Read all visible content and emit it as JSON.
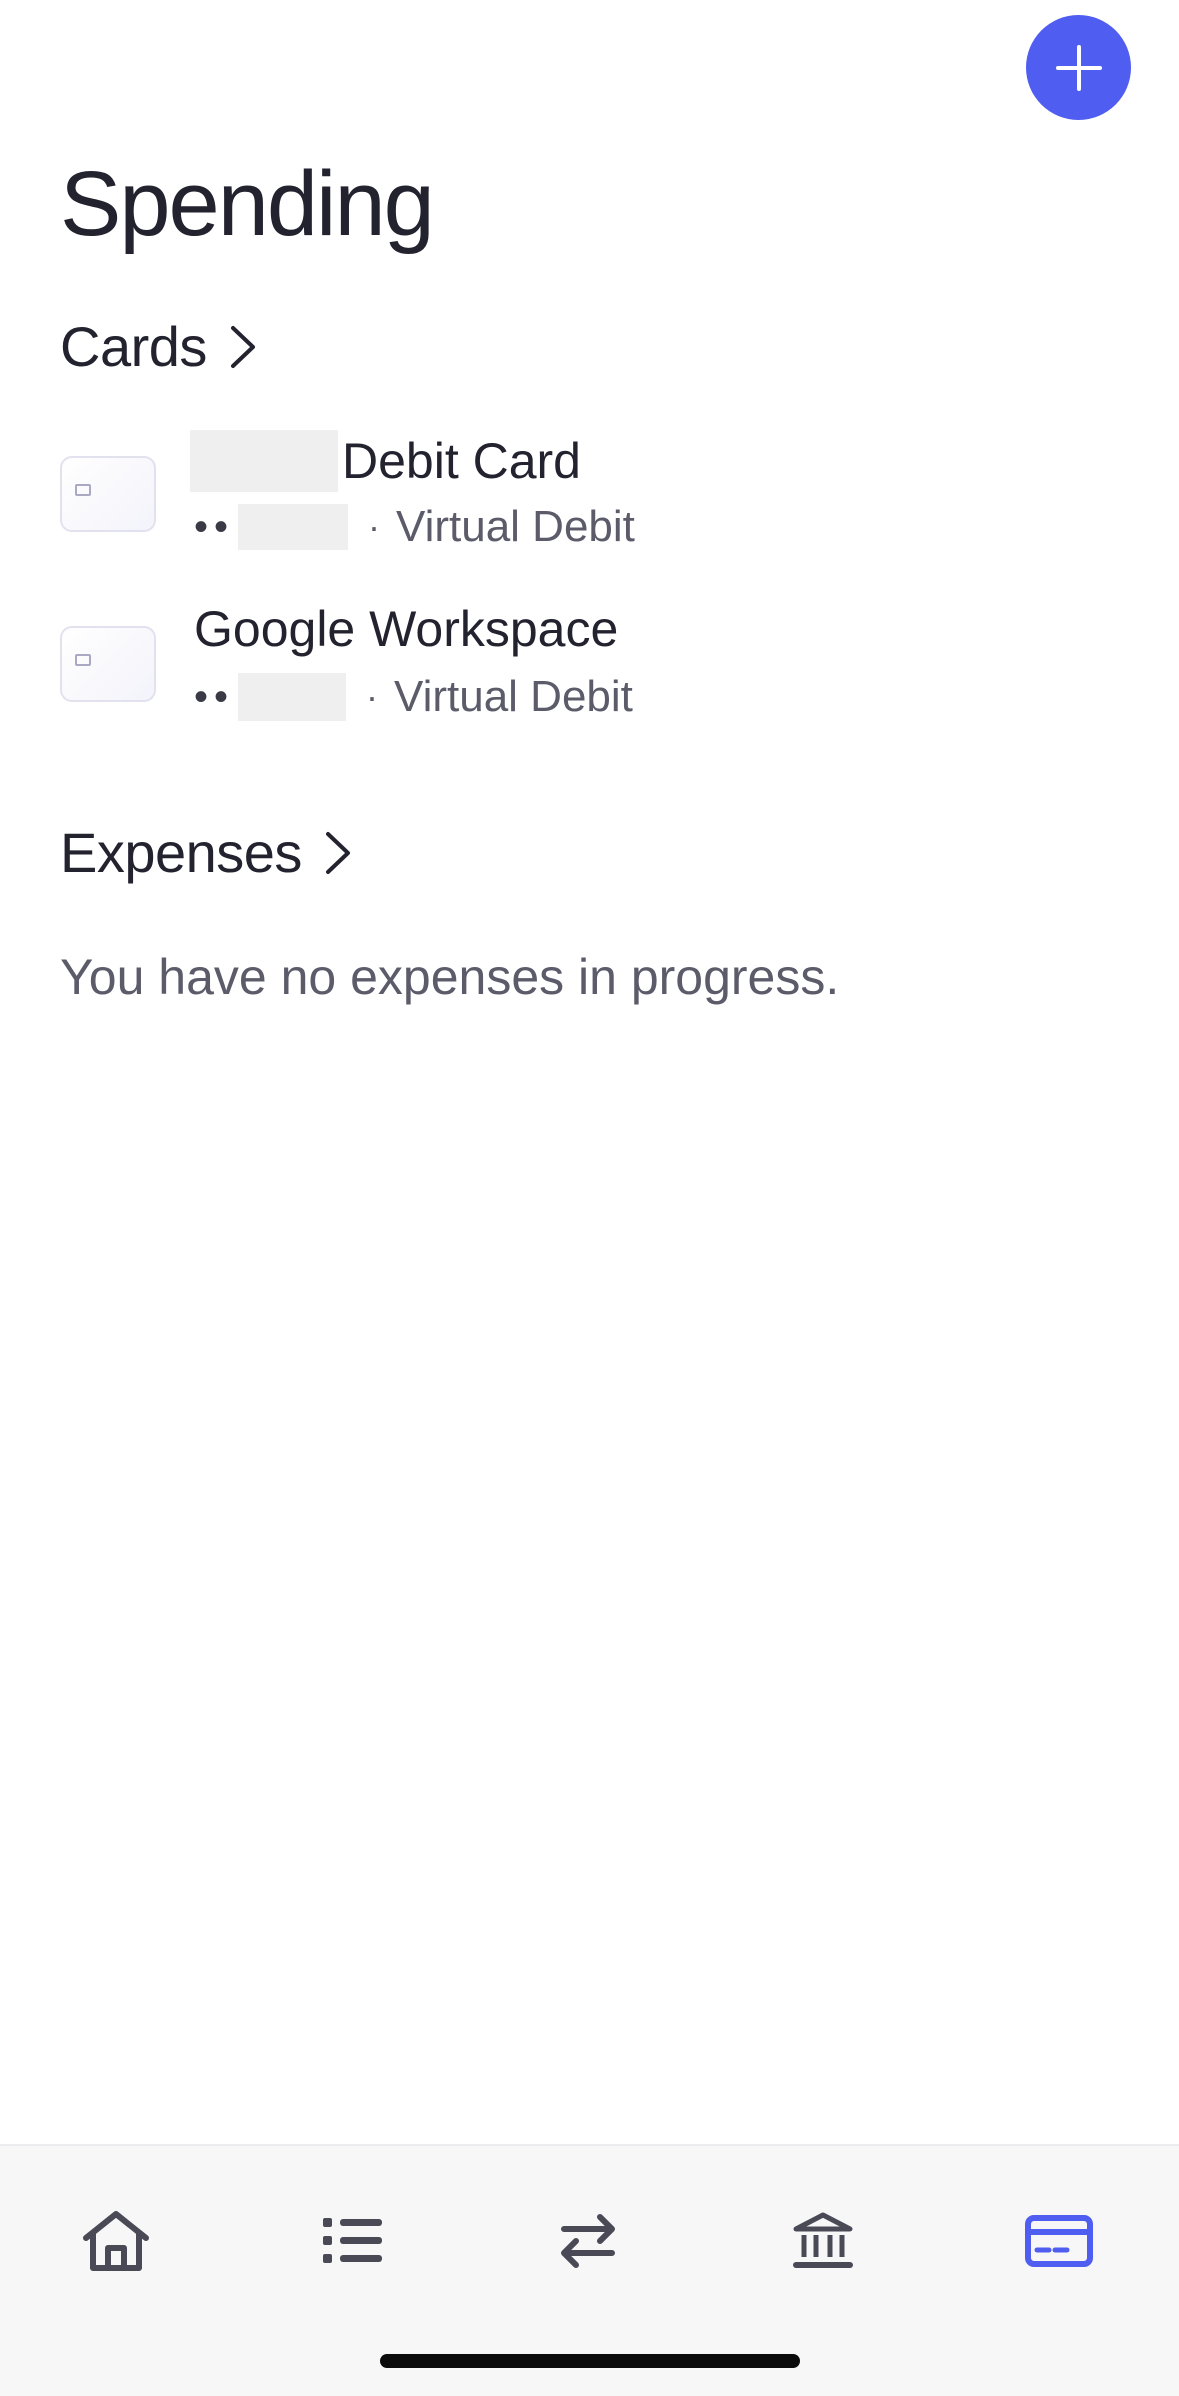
{
  "header": {
    "add_icon": "plus-icon",
    "title": "Spending"
  },
  "cards_section": {
    "label": "Cards",
    "items": [
      {
        "title": "Debit Card",
        "masked_prefix": "••",
        "type": "Virtual Debit"
      },
      {
        "title": "Google Workspace",
        "masked_prefix": "••",
        "type": "Virtual Debit"
      }
    ]
  },
  "expenses_section": {
    "label": "Expenses",
    "empty_message": "You have no expenses in progress."
  },
  "tabbar": {
    "tabs": [
      {
        "icon": "home-icon",
        "active": false
      },
      {
        "icon": "list-icon",
        "active": false
      },
      {
        "icon": "transfer-icon",
        "active": false
      },
      {
        "icon": "bank-icon",
        "active": false
      },
      {
        "icon": "card-icon",
        "active": true
      }
    ],
    "colors": {
      "active": "#4f5df0",
      "inactive": "#4a4a57"
    }
  },
  "colors": {
    "accent": "#4f5df0",
    "text": "#23222f",
    "muted": "#5b5b6a"
  }
}
